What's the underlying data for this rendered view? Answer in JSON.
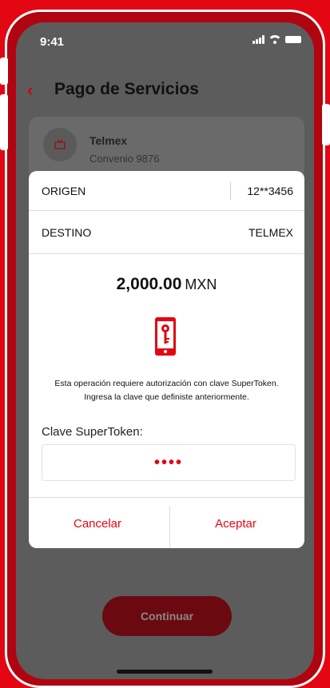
{
  "status": {
    "time": "9:41"
  },
  "header": {
    "back_icon": "chevron-left-icon",
    "title": "Pago de Servicios"
  },
  "service": {
    "icon": "tv-icon",
    "name": "Telmex",
    "agreement": "Convenio 9876"
  },
  "modal": {
    "origin_label": "ORIGEN",
    "origin_value": "12**3456",
    "destination_label": "DESTINO",
    "destination_value": "TELMEX",
    "amount": "2,000.00",
    "currency": "MXN",
    "token_icon": "phone-key-icon",
    "message_line1": "Esta operación requiere autorización con clave SuperToken.",
    "message_line2": "Ingresa la clave que definiste anteriormente.",
    "token_label": "Clave SuperToken:",
    "token_value": "••••",
    "cancel_label": "Cancelar",
    "accept_label": "Aceptar"
  },
  "footer": {
    "continue_label": "Continuar"
  },
  "colors": {
    "brand_red": "#e30613",
    "overlay": "#5c5c5c"
  }
}
